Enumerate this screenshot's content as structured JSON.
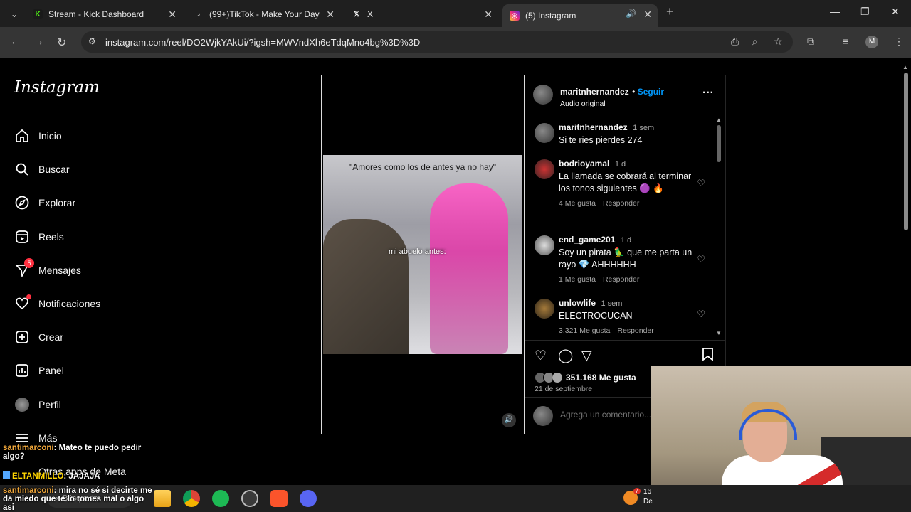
{
  "browser": {
    "tabs": [
      {
        "title": "Stream - Kick Dashboard",
        "icon": "kick-icon",
        "active": false
      },
      {
        "title": "(99+)TikTok - Make Your Day",
        "icon": "tiktok-icon",
        "active": false
      },
      {
        "title": "X",
        "icon": "x-icon",
        "active": false
      },
      {
        "title": "(5) Instagram",
        "icon": "instagram-icon",
        "active": true
      }
    ],
    "url": "instagram.com/reel/DO2WjkYAkUi/?igsh=MWVndXh6eTdqMno4bg%3D%3D",
    "profile_initial": "M"
  },
  "sidebar": {
    "logo": "Instagram",
    "items": [
      {
        "label": "Inicio",
        "icon": "home-icon"
      },
      {
        "label": "Buscar",
        "icon": "search-icon"
      },
      {
        "label": "Explorar",
        "icon": "compass-icon"
      },
      {
        "label": "Reels",
        "icon": "reels-icon"
      },
      {
        "label": "Mensajes",
        "icon": "messenger-icon",
        "badge": "5"
      },
      {
        "label": "Notificaciones",
        "icon": "heart-icon",
        "dot": true
      },
      {
        "label": "Crear",
        "icon": "plus-square-icon"
      },
      {
        "label": "Panel",
        "icon": "dashboard-icon"
      },
      {
        "label": "Perfil",
        "icon": "profile-avatar-icon"
      },
      {
        "label": "Más",
        "icon": "menu-icon"
      },
      {
        "label": "Otras apps de Meta",
        "icon": "meta-apps-icon"
      }
    ]
  },
  "reel": {
    "caption_text": "\"Amores como los de antes ya no hay\"",
    "overlay_label": "mi abuelo antes:"
  },
  "post": {
    "author": "maritnhernandez",
    "follow_label": "Seguir",
    "audio": "Audio original",
    "caption": {
      "user": "maritnhernandez",
      "time": "1 sem",
      "text": "Si te ries pierdes 274"
    },
    "comments": [
      {
        "user": "bodrioyamal",
        "time": "1 d",
        "text": "La llamada se cobrará al terminar los tonos siguientes 🟣 🔥",
        "likes": "4 Me gusta",
        "reply": "Responder"
      },
      {
        "user": "end_game201",
        "time": "1 d",
        "text": "Soy un pirata 🦜 que me parta un rayo 💎 AHHHHHH",
        "likes": "1 Me gusta",
        "reply": "Responder"
      },
      {
        "user": "unlowlife",
        "time": "1 sem",
        "text": "ELECTROCUCAN",
        "likes": "3.321 Me gusta",
        "reply": "Responder"
      }
    ],
    "likes_total": "351.168 Me gusta",
    "date": "21 de septiembre",
    "add_comment_placeholder": "Agrega un comentario..."
  },
  "chat": [
    {
      "user": "santimarconi",
      "text": ": Mateo te puedo pedir algo?"
    },
    {
      "user": "ELTANMILLO",
      "text": ": JAJAJA"
    },
    {
      "user": "santimarconi",
      "text": ": mira no sé si decirte me da miedo que te lo tomes mal o algo asi"
    }
  ],
  "taskbar": {
    "search_label": "Búsqueda",
    "weather": "16",
    "weather_badge": "7",
    "date_partial": "De"
  }
}
